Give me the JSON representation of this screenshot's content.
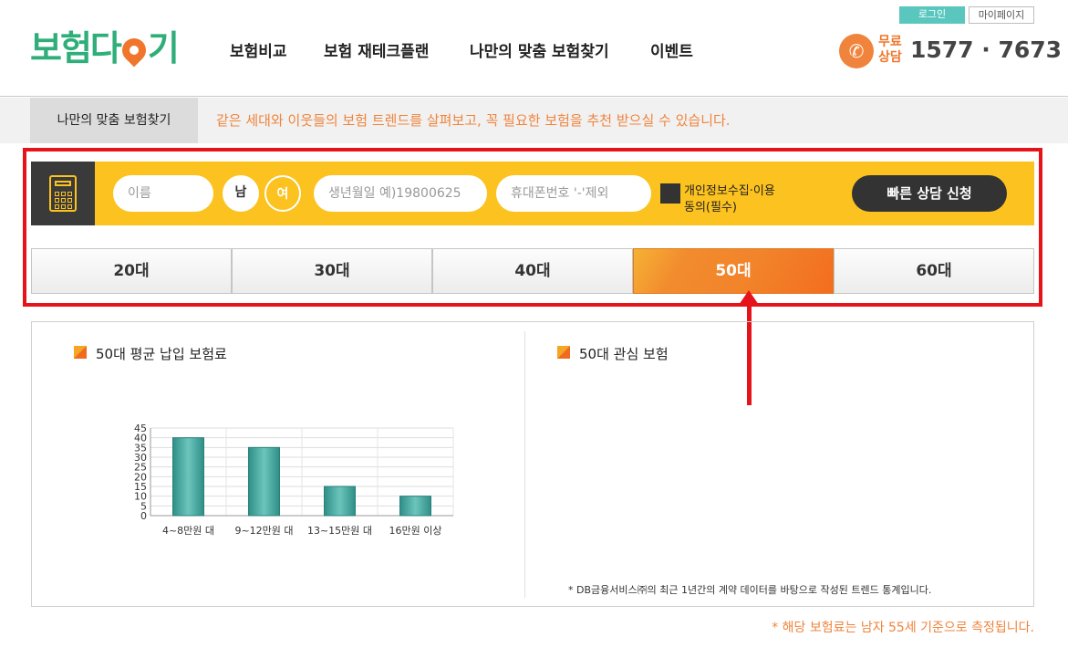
{
  "header": {
    "logo_text_a": "보험다",
    "logo_text_b": "기",
    "nav": [
      "보험비교",
      "보험 재테크플랜",
      "나만의 맞춤 보험찾기",
      "이벤트"
    ],
    "login": "로그인",
    "mypage": "마이페이지",
    "free_label": "무료\n상담",
    "free_line1": "무료",
    "free_line2": "상담",
    "phone": "1577 · 7673"
  },
  "subbar": {
    "tab": "나만의 맞춤 보험찾기",
    "description": "같은 세대와 이웃들의 보험 트렌드를 살펴보고, 꼭 필요한 보험을 추천 받으실 수 있습니다."
  },
  "form": {
    "name_placeholder": "이름",
    "male": "남",
    "female": "여",
    "birth_placeholder": "생년월일 예)19800625",
    "phone_placeholder": "휴대폰번호 '-'제외",
    "agree_line1": "개인정보수집·이용",
    "agree_line2": "동의(필수)",
    "consult_button": "빠른 상담 신청"
  },
  "age_tabs": [
    "20대",
    "30대",
    "40대",
    "50대",
    "60대"
  ],
  "active_age_tab": "50대",
  "content": {
    "left_title": "50대 평균 납입 보험료",
    "right_title": "50대 관심 보험",
    "note": "* DB금융서비스㈜의 최근 1년간의 계약 데이터를 바탕으로 작성된 트렌드 통계입니다.",
    "footnote": "* 해당 보험료는 남자 55세 기준으로 측정됩니다."
  },
  "colors": {
    "brand_green": "#2fae7a",
    "accent_orange": "#f0843c",
    "form_yellow": "#fcc21f",
    "highlight_red": "#e5141a",
    "bar_teal": "#3aa99f"
  },
  "chart_data": {
    "type": "bar",
    "categories": [
      "4~8만원 대",
      "9~12만원 대",
      "13~15만원 대",
      "16만원 이상"
    ],
    "values": [
      40,
      35,
      15,
      10
    ],
    "ylim": [
      0,
      45
    ],
    "yticks": [
      0,
      5,
      10,
      15,
      20,
      25,
      30,
      35,
      40,
      45
    ],
    "grid": true
  }
}
